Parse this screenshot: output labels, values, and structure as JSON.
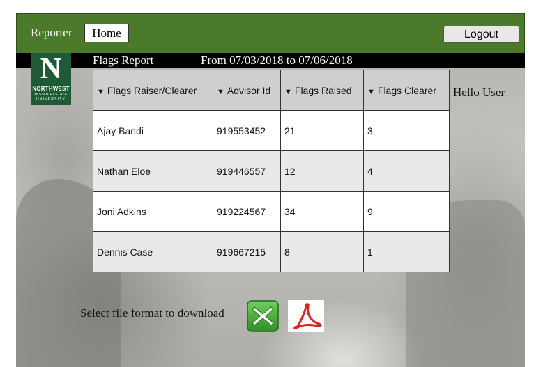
{
  "header": {
    "app_name": "Reporter",
    "home_label": "Home",
    "logout_label": "Logout"
  },
  "titlebar": {
    "report_title": "Flags Report",
    "date_range": "From 07/03/2018 to  07/06/2018"
  },
  "logo": {
    "letter": "N",
    "line1": "NORTHWEST",
    "line2": "MISSOURI STATE",
    "line3": "UNIVERSITY"
  },
  "table": {
    "sort_glyph": "▼",
    "columns": [
      "Flags Raiser/Clearer",
      "Advisor Id",
      "Flags Raised",
      "Flags Clearer"
    ],
    "rows": [
      [
        "Ajay Bandi",
        "919553452",
        "21",
        "3"
      ],
      [
        "Nathan Eloe",
        "919446557",
        "12",
        "4"
      ],
      [
        "Joni Adkins",
        "919224567",
        "34",
        "9"
      ],
      [
        "Dennis Case",
        "919667215",
        "8",
        "1"
      ]
    ]
  },
  "greeting": "Hello User",
  "download": {
    "label": "Select file format to download",
    "formats": [
      {
        "icon": "excel-x-icon",
        "color": "#3fa535"
      },
      {
        "icon": "pdf-acrobat-icon",
        "color": "#e0201b"
      }
    ]
  },
  "colors": {
    "header_green": "#4c7a2b",
    "logo_green": "#1e5b34",
    "titlebar": "#000000"
  }
}
